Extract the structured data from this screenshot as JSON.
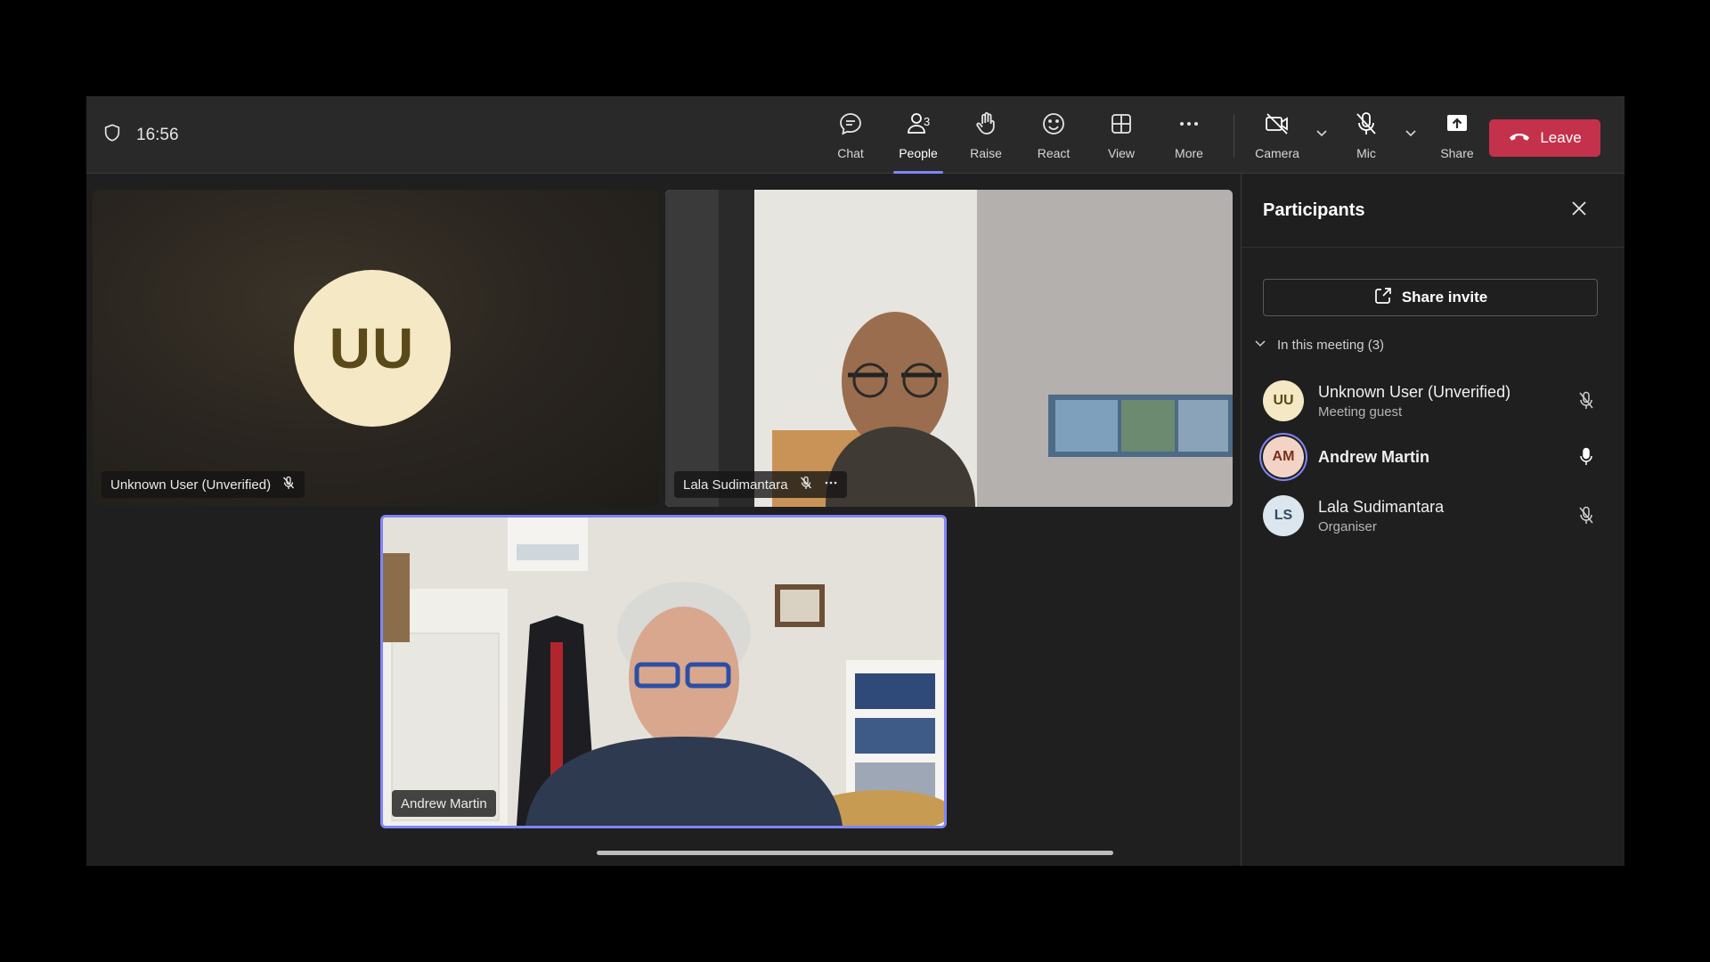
{
  "topbar": {
    "timer": "16:56"
  },
  "toolbar": {
    "chat": "Chat",
    "people": "People",
    "people_count": "3",
    "raise": "Raise",
    "react": "React",
    "view": "View",
    "more": "More",
    "camera": "Camera",
    "mic": "Mic",
    "share": "Share",
    "leave": "Leave"
  },
  "tiles": {
    "uu": {
      "initials": "UU",
      "name": "Unknown User (Unverified)"
    },
    "ls": {
      "name": "Lala Sudimantara"
    },
    "am": {
      "name": "Andrew Martin"
    }
  },
  "panel": {
    "title": "Participants",
    "share_invite": "Share invite",
    "section": "In this meeting (3)",
    "participants": [
      {
        "initials": "UU",
        "name": "Unknown User (Unverified)",
        "sub": "Meeting guest",
        "muted": true,
        "avatar_bg": "#f5e8c4",
        "avatar_fg": "#5a4a1a"
      },
      {
        "initials": "AM",
        "name": "Andrew Martin",
        "sub": "",
        "muted": false,
        "avatar_bg": "#f4d3c7",
        "avatar_fg": "#7a2f1a"
      },
      {
        "initials": "LS",
        "name": "Lala Sudimantara",
        "sub": "Organiser",
        "muted": true,
        "avatar_bg": "#dce6ef",
        "avatar_fg": "#2f4a63"
      }
    ]
  },
  "colors": {
    "accent": "#7f85f5",
    "leave": "#c4314b"
  }
}
